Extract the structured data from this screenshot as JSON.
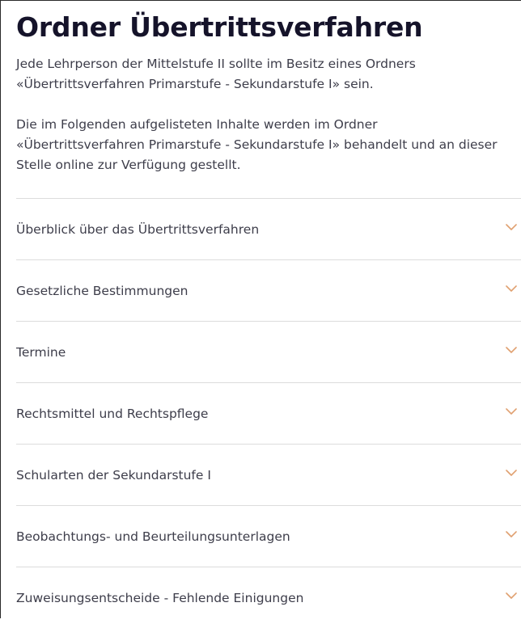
{
  "page": {
    "title": "Ordner Übertrittsverfahren",
    "intro_paragraphs": [
      "Jede Lehrperson der Mittelstufe II sollte im Besitz eines Ordners «Übertrittsverfahren Primarstufe - Sekundarstufe I» sein.",
      "Die im Folgenden aufgelisteten Inhalte werden im Ordner «Übertrittsverfahren Primarstufe - Sekundarstufe I» behandelt und an dieser Stelle online zur Verfügung gestellt."
    ]
  },
  "accordion": {
    "chevron_icon": "chevron-down-icon",
    "chevron_color": "#e0a070",
    "items": [
      {
        "label": "Überblick über das Übertrittsverfahren"
      },
      {
        "label": "Gesetzliche Bestimmungen"
      },
      {
        "label": "Termine"
      },
      {
        "label": "Rechtsmittel und Rechtspflege"
      },
      {
        "label": "Schularten der Sekundarstufe I"
      },
      {
        "label": "Beobachtungs- und Beurteilungsunterlagen"
      },
      {
        "label": "Zuweisungsentscheide - Fehlende Einigungen"
      }
    ]
  }
}
